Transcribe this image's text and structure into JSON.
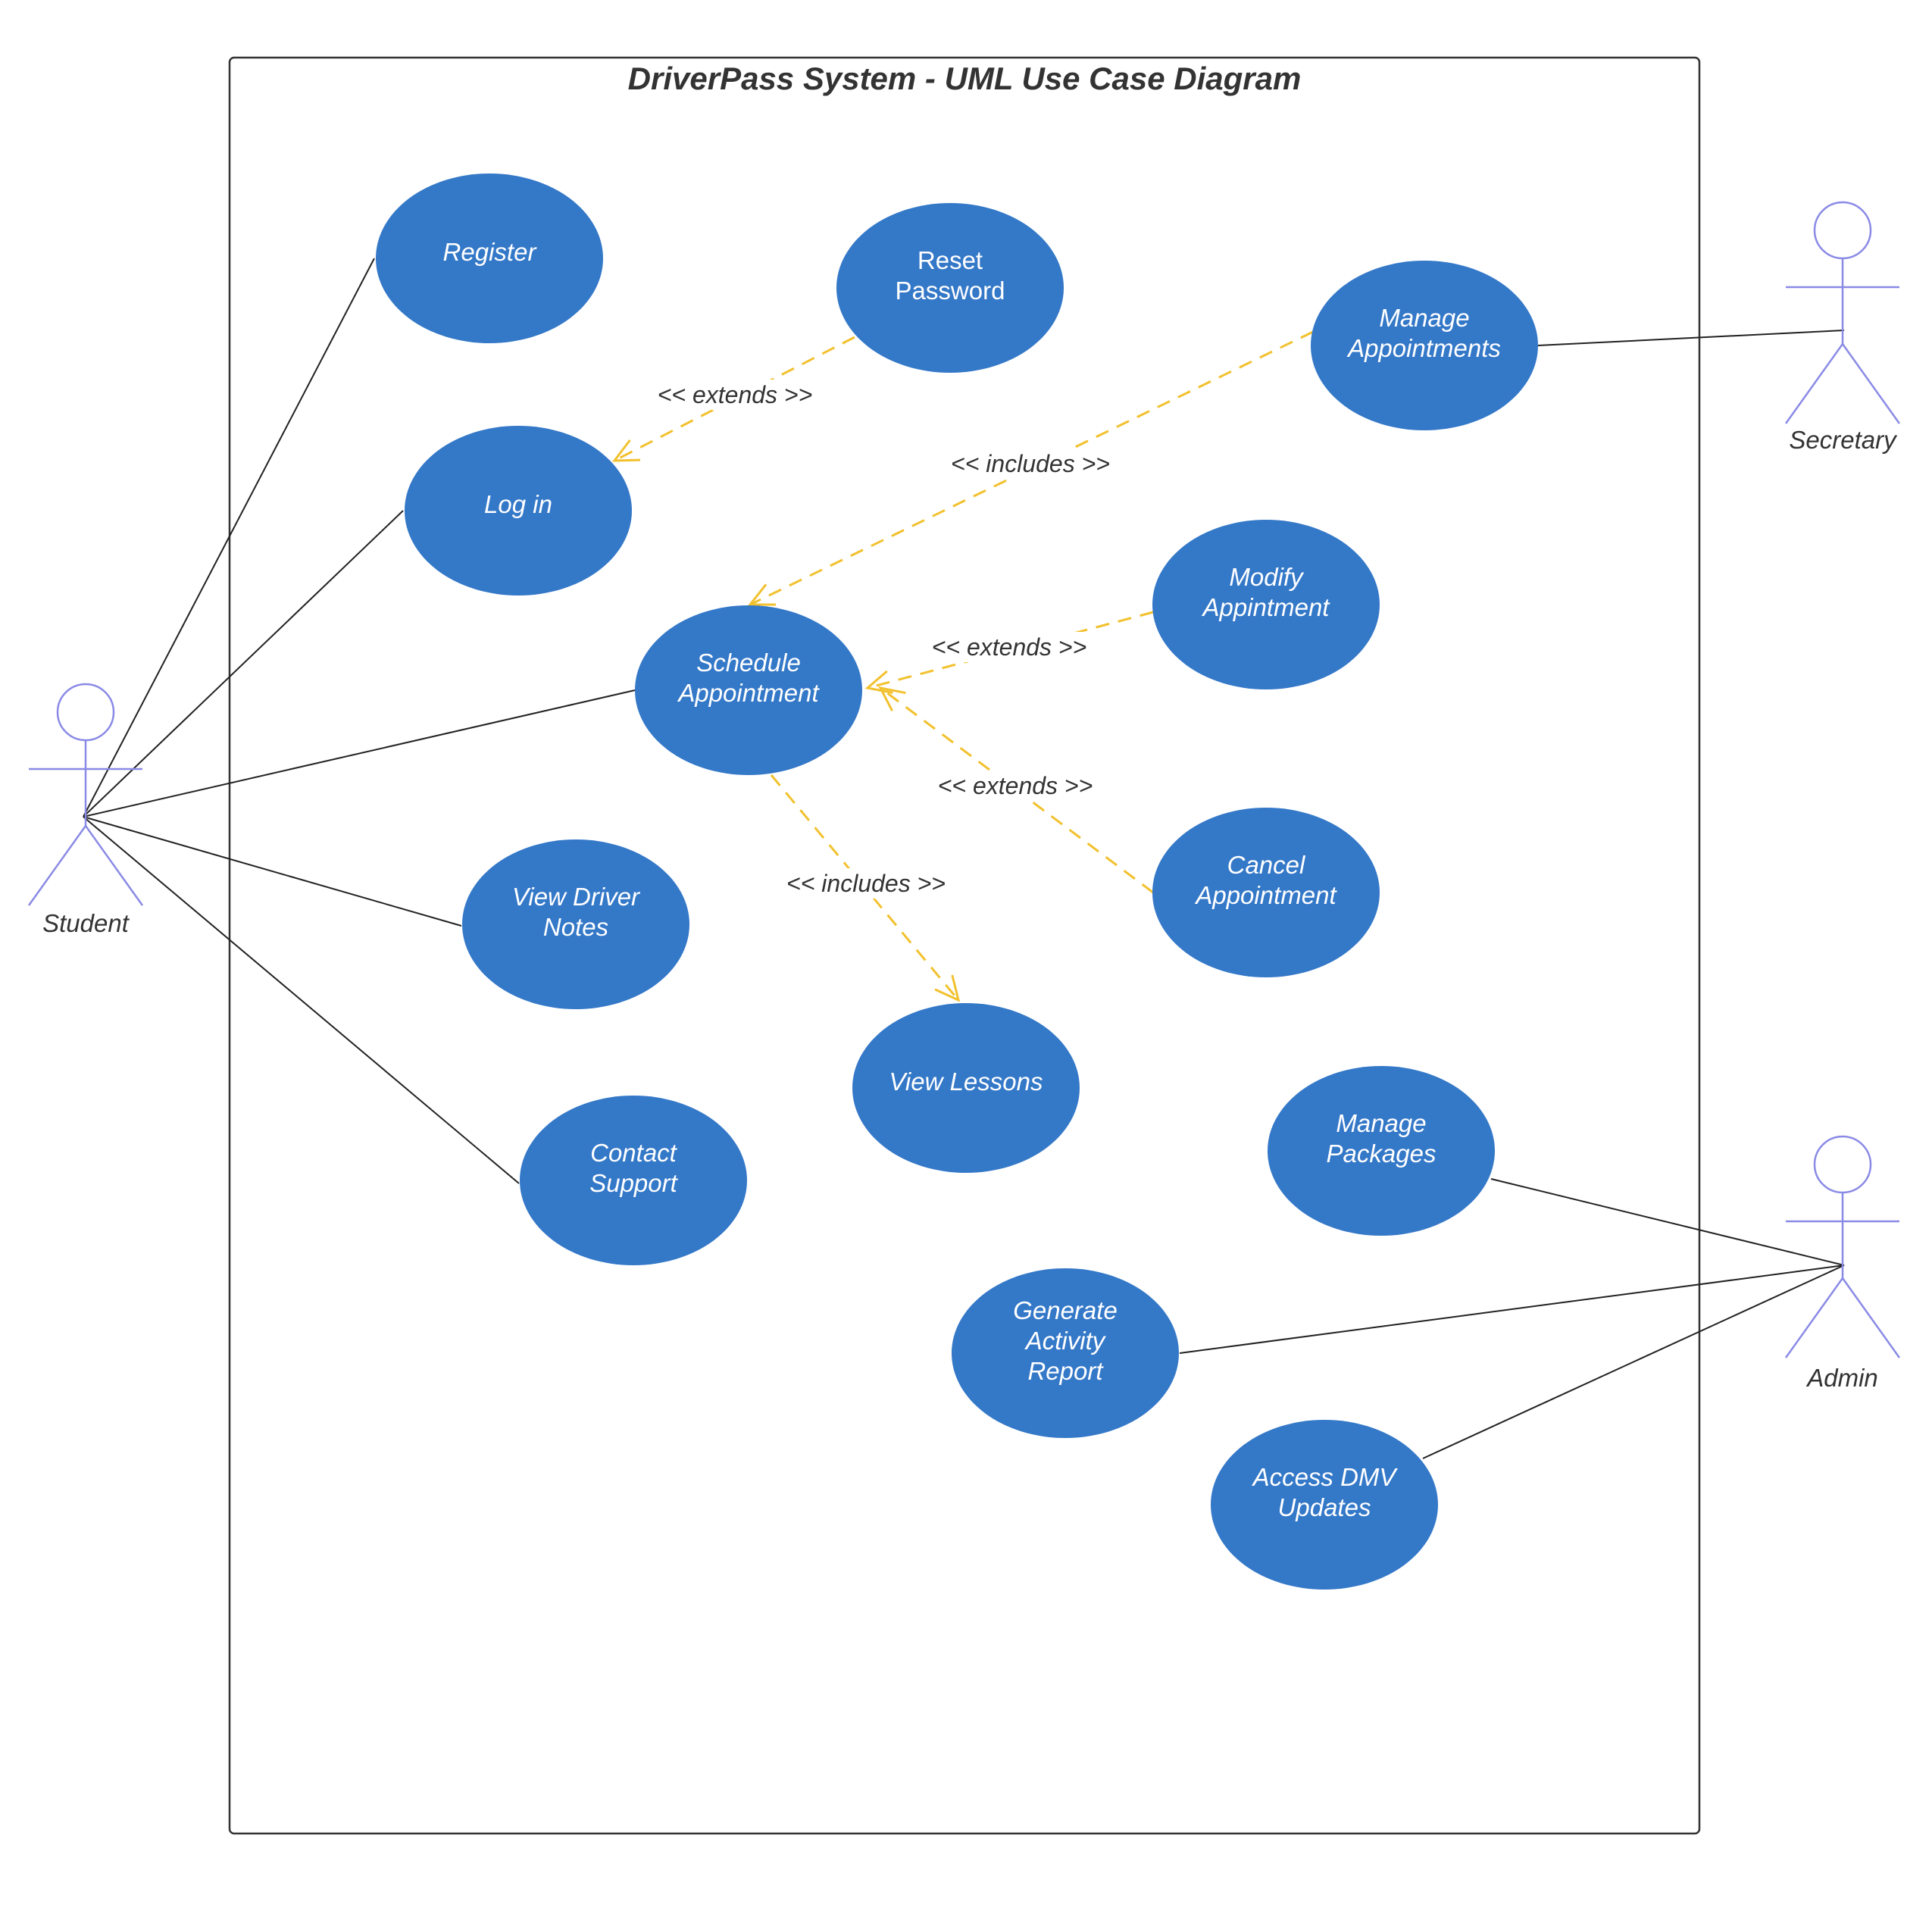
{
  "diagram": {
    "title": "DriverPass System - UML Use Case Diagram",
    "colors": {
      "use_case_fill": "#3478C8",
      "use_case_text": "#FFFFFF",
      "actor_stroke": "#8A8AE6",
      "association": "#222222",
      "dependency": "#F2C12E",
      "boundary": "#333333",
      "label_text": "#333333"
    },
    "actors": [
      {
        "id": "student",
        "label": "Student"
      },
      {
        "id": "secretary",
        "label": "Secretary"
      },
      {
        "id": "admin",
        "label": "Admin"
      }
    ],
    "use_cases": [
      {
        "id": "register",
        "lines": [
          "Register"
        ]
      },
      {
        "id": "reset_password",
        "lines": [
          "Reset",
          "Password"
        ]
      },
      {
        "id": "log_in",
        "lines": [
          "Log in"
        ]
      },
      {
        "id": "manage_appointments",
        "lines": [
          "Manage",
          "Appointments"
        ]
      },
      {
        "id": "schedule_appointment",
        "lines": [
          "Schedule",
          "Appointment"
        ]
      },
      {
        "id": "modify_appointment",
        "lines": [
          "Modify",
          "Appintment"
        ]
      },
      {
        "id": "cancel_appointment",
        "lines": [
          "Cancel",
          "Appointment"
        ]
      },
      {
        "id": "view_driver_notes",
        "lines": [
          "View Driver",
          "Notes"
        ]
      },
      {
        "id": "view_lessons",
        "lines": [
          "View Lessons"
        ]
      },
      {
        "id": "contact_support",
        "lines": [
          "Contact",
          "Support"
        ]
      },
      {
        "id": "manage_packages",
        "lines": [
          "Manage",
          "Packages"
        ]
      },
      {
        "id": "generate_activity_report",
        "lines": [
          "Generate",
          "Activity",
          "Report"
        ]
      },
      {
        "id": "access_dmv_updates",
        "lines": [
          "Access DMV",
          "Updates"
        ]
      }
    ],
    "associations": [
      {
        "actor": "student",
        "use_case": "register"
      },
      {
        "actor": "student",
        "use_case": "log_in"
      },
      {
        "actor": "student",
        "use_case": "schedule_appointment"
      },
      {
        "actor": "student",
        "use_case": "view_driver_notes"
      },
      {
        "actor": "student",
        "use_case": "contact_support"
      },
      {
        "actor": "secretary",
        "use_case": "manage_appointments"
      },
      {
        "actor": "admin",
        "use_case": "manage_packages"
      },
      {
        "actor": "admin",
        "use_case": "generate_activity_report"
      },
      {
        "actor": "admin",
        "use_case": "access_dmv_updates"
      }
    ],
    "relationships": [
      {
        "from": "reset_password",
        "to": "log_in",
        "label": "<< extends >>"
      },
      {
        "from": "manage_appointments",
        "to": "schedule_appointment",
        "label": "<< includes >>"
      },
      {
        "from": "modify_appointment",
        "to": "schedule_appointment",
        "label": "<< extends >>"
      },
      {
        "from": "cancel_appointment",
        "to": "schedule_appointment",
        "label": "<< extends >>"
      },
      {
        "from": "schedule_appointment",
        "to": "view_lessons",
        "label": "<< includes >>"
      }
    ]
  }
}
